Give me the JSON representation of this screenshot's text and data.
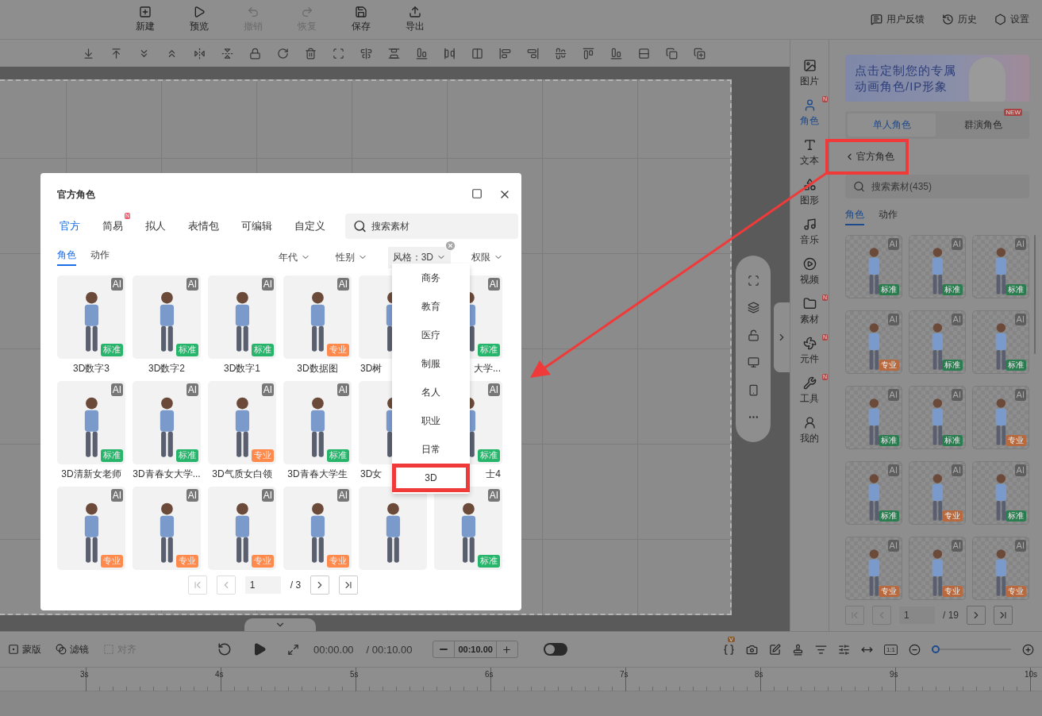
{
  "toolbar": {
    "buttons": [
      {
        "label": "新建",
        "kind": "new",
        "disabled": false
      },
      {
        "label": "预览",
        "kind": "preview",
        "disabled": false
      },
      {
        "label": "撤销",
        "kind": "undo",
        "disabled": true
      },
      {
        "label": "恢复",
        "kind": "redo",
        "disabled": true
      },
      {
        "label": "保存",
        "kind": "save",
        "disabled": false
      },
      {
        "label": "导出",
        "kind": "export",
        "disabled": false
      }
    ]
  },
  "header_links": [
    {
      "label": "用户反馈",
      "kind": "feedback"
    },
    {
      "label": "历史",
      "kind": "history"
    },
    {
      "label": "设置",
      "kind": "settings"
    }
  ],
  "side_nav": {
    "items": [
      {
        "label": "图片",
        "kind": "image",
        "selected": false
      },
      {
        "label": "角色",
        "kind": "character",
        "selected": true,
        "badge": "N"
      },
      {
        "label": "文本",
        "kind": "text",
        "selected": false
      },
      {
        "label": "图形",
        "kind": "shape",
        "selected": false
      },
      {
        "label": "音乐",
        "kind": "music",
        "selected": false
      },
      {
        "label": "视频",
        "kind": "video",
        "selected": false
      },
      {
        "label": "素材",
        "kind": "folder",
        "selected": false,
        "badge": "N"
      },
      {
        "label": "元件",
        "kind": "component",
        "selected": false,
        "badge": "N"
      },
      {
        "label": "工具",
        "kind": "tool",
        "selected": false,
        "badge": "N"
      },
      {
        "label": "我的",
        "kind": "me",
        "selected": false
      }
    ]
  },
  "panel": {
    "banner": {
      "lines": [
        "点击定制您的专属",
        "动画角色/IP形象"
      ]
    },
    "mode_tabs": [
      {
        "label": "单人角色",
        "selected": true
      },
      {
        "label": "群演角色",
        "selected": false,
        "badge": "NEW"
      }
    ],
    "back_link": {
      "label": "官方角色",
      "highlighted": true
    },
    "search": {
      "placeholder": "搜索素材(435)"
    },
    "sub_tabs": [
      {
        "label": "角色",
        "selected": true
      },
      {
        "label": "动作",
        "selected": false
      }
    ],
    "cards": [
      {
        "ai": "AI",
        "tag": "标准",
        "kind": "standard"
      },
      {
        "ai": "AI",
        "tag": "标准",
        "kind": "standard"
      },
      {
        "ai": "AI",
        "tag": "标准",
        "kind": "standard"
      },
      {
        "ai": "AI",
        "tag": "专业",
        "kind": "pro"
      },
      {
        "ai": "AI",
        "tag": "标准",
        "kind": "standard"
      },
      {
        "ai": "AI",
        "tag": "标准",
        "kind": "standard"
      },
      {
        "ai": "AI",
        "tag": "标准",
        "kind": "standard"
      },
      {
        "ai": "AI",
        "tag": "标准",
        "kind": "standard"
      },
      {
        "ai": "AI",
        "tag": "专业",
        "kind": "pro"
      },
      {
        "ai": "AI",
        "tag": "标准",
        "kind": "standard"
      },
      {
        "ai": "AI",
        "tag": "专业",
        "kind": "pro"
      },
      {
        "ai": "AI",
        "tag": "标准",
        "kind": "standard"
      },
      {
        "ai": "AI",
        "tag": "专业",
        "kind": "pro"
      },
      {
        "ai": "AI",
        "tag": "专业",
        "kind": "pro"
      },
      {
        "ai": "AI",
        "tag": "专业",
        "kind": "pro"
      }
    ],
    "pagination": {
      "page": "1",
      "total": "/ 19"
    }
  },
  "modal": {
    "title": "官方角色",
    "tabs": [
      {
        "label": "官方",
        "selected": true
      },
      {
        "label": "简易",
        "selected": false,
        "badge": "N"
      },
      {
        "label": "拟人",
        "selected": false
      },
      {
        "label": "表情包",
        "selected": false
      },
      {
        "label": "可编辑",
        "selected": false
      },
      {
        "label": "自定义",
        "selected": false
      }
    ],
    "search": {
      "placeholder": "搜索素材"
    },
    "sub_tabs": [
      {
        "label": "角色",
        "selected": true
      },
      {
        "label": "动作",
        "selected": false
      }
    ],
    "filters": [
      {
        "label": "年代",
        "active": false
      },
      {
        "label": "性别",
        "active": false
      },
      {
        "label": "风格：3D",
        "active": true
      },
      {
        "label": "权限",
        "active": false
      }
    ],
    "cards": [
      {
        "name": "3D数字3",
        "ai": "AI",
        "tag": "标准",
        "kind": "standard",
        "selected": false
      },
      {
        "name": "3D数字2",
        "ai": "AI",
        "tag": "标准",
        "kind": "standard",
        "selected": false
      },
      {
        "name": "3D数字1",
        "ai": "AI",
        "tag": "标准",
        "kind": "standard",
        "selected": false
      },
      {
        "name": "3D数据图",
        "ai": "AI",
        "tag": "专业",
        "kind": "pro",
        "selected": false
      },
      {
        "name": "3D树",
        "selected": false
      },
      {
        "name": "大学...",
        "ai": "AI",
        "tag": "标准",
        "kind": "standard",
        "selected": false
      },
      {
        "name": "3D清新女老师",
        "ai": "AI",
        "tag": "标准",
        "kind": "standard",
        "selected": false
      },
      {
        "name": "3D青春女大学...",
        "ai": "AI",
        "tag": "标准",
        "kind": "standard",
        "selected": false
      },
      {
        "name": "3D气质女白领",
        "ai": "AI",
        "tag": "专业",
        "kind": "pro",
        "selected": false
      },
      {
        "name": "3D青春大学生",
        "ai": "AI",
        "tag": "标准",
        "kind": "standard",
        "selected": false
      },
      {
        "name": "3D女",
        "selected": false
      },
      {
        "name": "士4",
        "ai": "AI",
        "tag": "标准",
        "kind": "standard",
        "selected": false
      },
      {
        "ai": "AI",
        "tag": "专业",
        "kind": "pro",
        "selected": false
      },
      {
        "ai": "AI",
        "tag": "专业",
        "kind": "pro",
        "selected": false
      },
      {
        "ai": "AI",
        "tag": "专业",
        "kind": "pro",
        "selected": false
      },
      {
        "ai": "AI",
        "tag": "专业",
        "kind": "pro",
        "selected": false
      },
      {
        "selected": false
      },
      {
        "ai": "AI",
        "tag": "标准",
        "kind": "standard",
        "selected": false
      }
    ],
    "style_menu": {
      "items": [
        {
          "label": "商务",
          "selected": false
        },
        {
          "label": "教育",
          "selected": false
        },
        {
          "label": "医疗",
          "selected": false
        },
        {
          "label": "制服",
          "selected": false
        },
        {
          "label": "名人",
          "selected": false
        },
        {
          "label": "职业",
          "selected": false
        },
        {
          "label": "日常",
          "selected": false
        },
        {
          "label": "3D",
          "selected": true
        }
      ]
    },
    "pagination": {
      "page": "1",
      "total": "/ 3"
    }
  },
  "timeline": {
    "tools": [
      {
        "label": "蒙版",
        "kind": "mask",
        "disabled": false
      },
      {
        "label": "滤镜",
        "kind": "filter",
        "disabled": false
      },
      {
        "label": "对齐",
        "kind": "align",
        "disabled": true
      }
    ],
    "time": "00:00.00",
    "total": "/ 00:10.00",
    "duration": "00:10.00",
    "loop_toggle": {
      "on": false
    },
    "badge": "V",
    "ratio": "1:1",
    "zoom": {
      "level": 0.05
    },
    "ruler": [
      "3s",
      "4s",
      "5s",
      "6s",
      "7s",
      "8s",
      "9s",
      "10s"
    ]
  }
}
